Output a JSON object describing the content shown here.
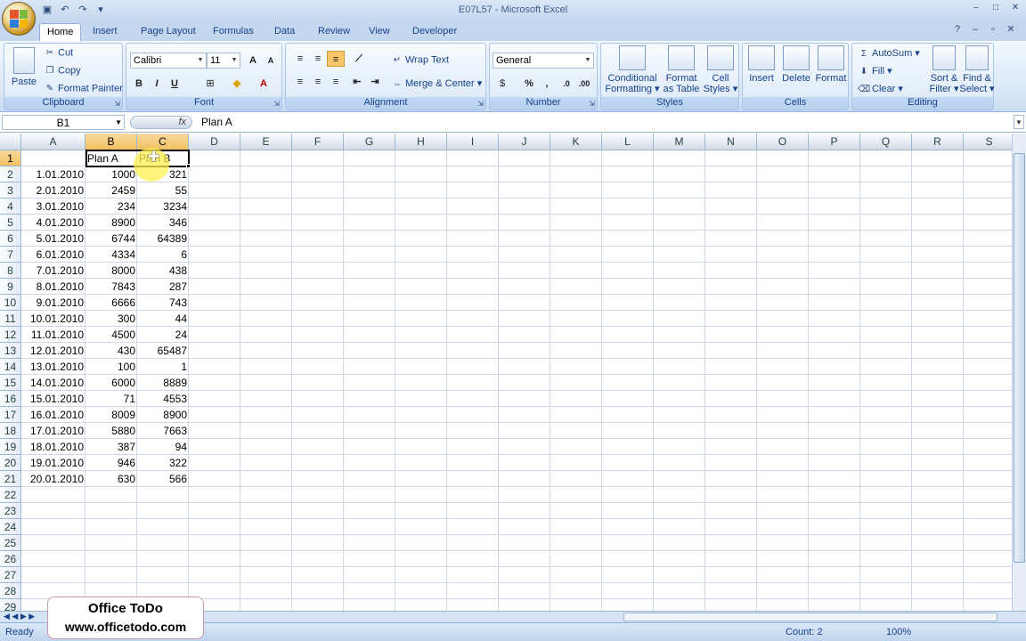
{
  "window": {
    "title": "E07L57 - Microsoft Excel"
  },
  "tabs": [
    {
      "label": "Home",
      "active": true
    },
    {
      "label": "Insert"
    },
    {
      "label": "Page Layout"
    },
    {
      "label": "Formulas"
    },
    {
      "label": "Data"
    },
    {
      "label": "Review"
    },
    {
      "label": "View"
    },
    {
      "label": "Developer"
    }
  ],
  "ribbon": {
    "clipboard": {
      "label": "Clipboard",
      "paste": "Paste",
      "cut": "Cut",
      "copy": "Copy",
      "format_painter": "Format Painter"
    },
    "font": {
      "label": "Font",
      "name": "Calibri",
      "size": "11"
    },
    "alignment": {
      "label": "Alignment",
      "wrap": "Wrap Text",
      "merge": "Merge & Center"
    },
    "number": {
      "label": "Number",
      "format": "General"
    },
    "styles": {
      "label": "Styles",
      "conditional_1": "Conditional",
      "conditional_2": "Formatting",
      "format_table_1": "Format",
      "format_table_2": "as Table",
      "cell_styles_1": "Cell",
      "cell_styles_2": "Styles"
    },
    "cells": {
      "label": "Cells",
      "insert": "Insert",
      "delete": "Delete",
      "format": "Format"
    },
    "editing": {
      "label": "Editing",
      "autosum": "AutoSum",
      "fill": "Fill",
      "clear": "Clear",
      "sort_1": "Sort &",
      "sort_2": "Filter",
      "find_1": "Find &",
      "find_2": "Select"
    }
  },
  "formula_bar": {
    "name_box": "B1",
    "content": "Plan A"
  },
  "columns": [
    "A",
    "B",
    "C",
    "D",
    "E",
    "F",
    "G",
    "H",
    "I",
    "J",
    "K",
    "L",
    "M",
    "N",
    "O",
    "P",
    "Q",
    "R",
    "S"
  ],
  "rows": [
    {
      "n": "1",
      "a": "",
      "b": "Plan A",
      "c": "Plan B"
    },
    {
      "n": "2",
      "a": "1.01.2010",
      "b": "1000",
      "c": "321"
    },
    {
      "n": "3",
      "a": "2.01.2010",
      "b": "2459",
      "c": "55"
    },
    {
      "n": "4",
      "a": "3.01.2010",
      "b": "234",
      "c": "3234"
    },
    {
      "n": "5",
      "a": "4.01.2010",
      "b": "8900",
      "c": "346"
    },
    {
      "n": "6",
      "a": "5.01.2010",
      "b": "6744",
      "c": "64389"
    },
    {
      "n": "7",
      "a": "6.01.2010",
      "b": "4334",
      "c": "6"
    },
    {
      "n": "8",
      "a": "7.01.2010",
      "b": "8000",
      "c": "438"
    },
    {
      "n": "9",
      "a": "8.01.2010",
      "b": "7843",
      "c": "287"
    },
    {
      "n": "10",
      "a": "9.01.2010",
      "b": "6666",
      "c": "743"
    },
    {
      "n": "11",
      "a": "10.01.2010",
      "b": "300",
      "c": "44"
    },
    {
      "n": "12",
      "a": "11.01.2010",
      "b": "4500",
      "c": "24"
    },
    {
      "n": "13",
      "a": "12.01.2010",
      "b": "430",
      "c": "65487"
    },
    {
      "n": "14",
      "a": "13.01.2010",
      "b": "100",
      "c": "1"
    },
    {
      "n": "15",
      "a": "14.01.2010",
      "b": "6000",
      "c": "8889"
    },
    {
      "n": "16",
      "a": "15.01.2010",
      "b": "71",
      "c": "4553"
    },
    {
      "n": "17",
      "a": "16.01.2010",
      "b": "8009",
      "c": "8900"
    },
    {
      "n": "18",
      "a": "17.01.2010",
      "b": "5880",
      "c": "7663"
    },
    {
      "n": "19",
      "a": "18.01.2010",
      "b": "387",
      "c": "94"
    },
    {
      "n": "20",
      "a": "19.01.2010",
      "b": "946",
      "c": "322"
    },
    {
      "n": "21",
      "a": "20.01.2010",
      "b": "630",
      "c": "566"
    },
    {
      "n": "22",
      "a": "",
      "b": "",
      "c": ""
    },
    {
      "n": "23",
      "a": "",
      "b": "",
      "c": ""
    },
    {
      "n": "24",
      "a": "",
      "b": "",
      "c": ""
    },
    {
      "n": "25",
      "a": "",
      "b": "",
      "c": ""
    },
    {
      "n": "26",
      "a": "",
      "b": "",
      "c": ""
    },
    {
      "n": "27",
      "a": "",
      "b": "",
      "c": ""
    },
    {
      "n": "28",
      "a": "",
      "b": "",
      "c": ""
    },
    {
      "n": "29",
      "a": "",
      "b": "",
      "c": ""
    }
  ],
  "status": {
    "ready": "Ready",
    "count": "Count: 2",
    "zoom": "100%"
  },
  "watermark": {
    "line1": "Office ToDo",
    "line2": "www.officetodo.com"
  }
}
